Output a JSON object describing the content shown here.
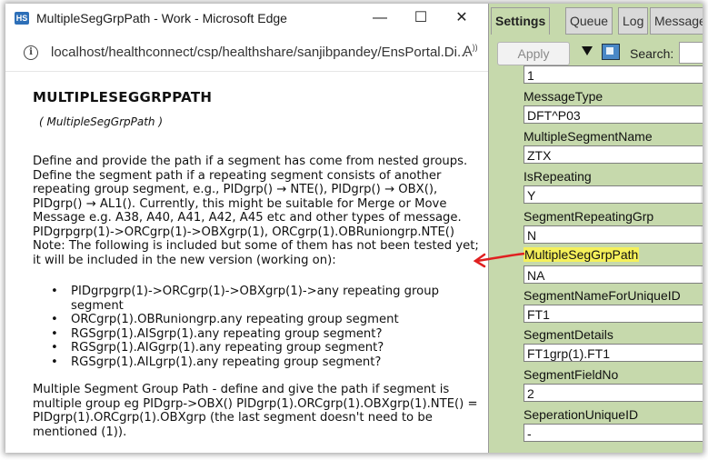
{
  "window": {
    "title": "MultipleSegGrpPath - Work - Microsoft Edge",
    "app_icon": "HS",
    "url": "localhost/healthconnect/csp/healthshare/sanjibpandey/EnsPortal.Di..."
  },
  "content": {
    "heading": "MULTIPLESEGGRPPATH",
    "subheading": "( MultipleSegGrpPath )",
    "paragraph1": "Define and provide the path if a segment has come from nested groups. Define the segment path if a repeating segment consists of another repeating group segment, e.g., PIDgrp() → NTE(), PIDgrp() → OBX(), PIDgrp() → AL1(). Currently, this might be suitable for Merge or Move Message e.g. A38, A40, A41, A42, A45 etc and other types of message. PIDgrpgrp(1)->ORCgrp(1)->OBXgrp(1), ORCgrp(1).OBRuniongrp.NTE() Note: The following is included but some of them has not been tested yet; it will be included in the new version (working on):",
    "bullets": [
      "PIDgrpgrp(1)->ORCgrp(1)->OBXgrp(1)->any repeating group segment",
      "ORCgrp(1).OBRuniongrp.any repeating group segment",
      "RGSgrp(1).AISgrp(1).any repeating group segment?",
      "RGSgrp(1).AIGgrp(1).any repeating group segment?",
      "RGSgrp(1).AILgrp(1).any repeating group segment?"
    ],
    "paragraph2": "Multiple Segment Group Path - define and give the path if segment is multiple group eg PIDgrp->OBX() PIDgrp(1).ORCgrp(1).OBXgrp(1).NTE() = PIDgrp(1).ORCgrp(1).OBXgrp (the last segment doesn't need to be mentioned (1))."
  },
  "panel": {
    "tabs": [
      "Settings",
      "Queue",
      "Log",
      "Messages"
    ],
    "apply_label": "Apply",
    "search_label": "Search:",
    "first_value": "1",
    "fields": [
      {
        "label": "MessageType",
        "value": "DFT^P03",
        "dropdown": false
      },
      {
        "label": "MultipleSegmentName",
        "value": "ZTX",
        "dropdown": false
      },
      {
        "label": "IsRepeating",
        "value": "Y",
        "dropdown": true
      },
      {
        "label": "SegmentRepeatingGrp",
        "value": "N",
        "dropdown": true
      },
      {
        "label": "MultipleSegGrpPath",
        "value": "NA",
        "dropdown": true
      },
      {
        "label": "SegmentNameForUniqueID",
        "value": "FT1",
        "dropdown": false
      },
      {
        "label": "SegmentDetails",
        "value": "FT1grp(1).FT1",
        "dropdown": false
      },
      {
        "label": "SegmentFieldNo",
        "value": "2",
        "dropdown": false
      },
      {
        "label": "SeperationUniqueID",
        "value": "-",
        "dropdown": false
      }
    ],
    "highlight_color": "#f5f05a",
    "panel_color": "#c6d9ac",
    "annotation_arrow_color": "#e02020"
  }
}
